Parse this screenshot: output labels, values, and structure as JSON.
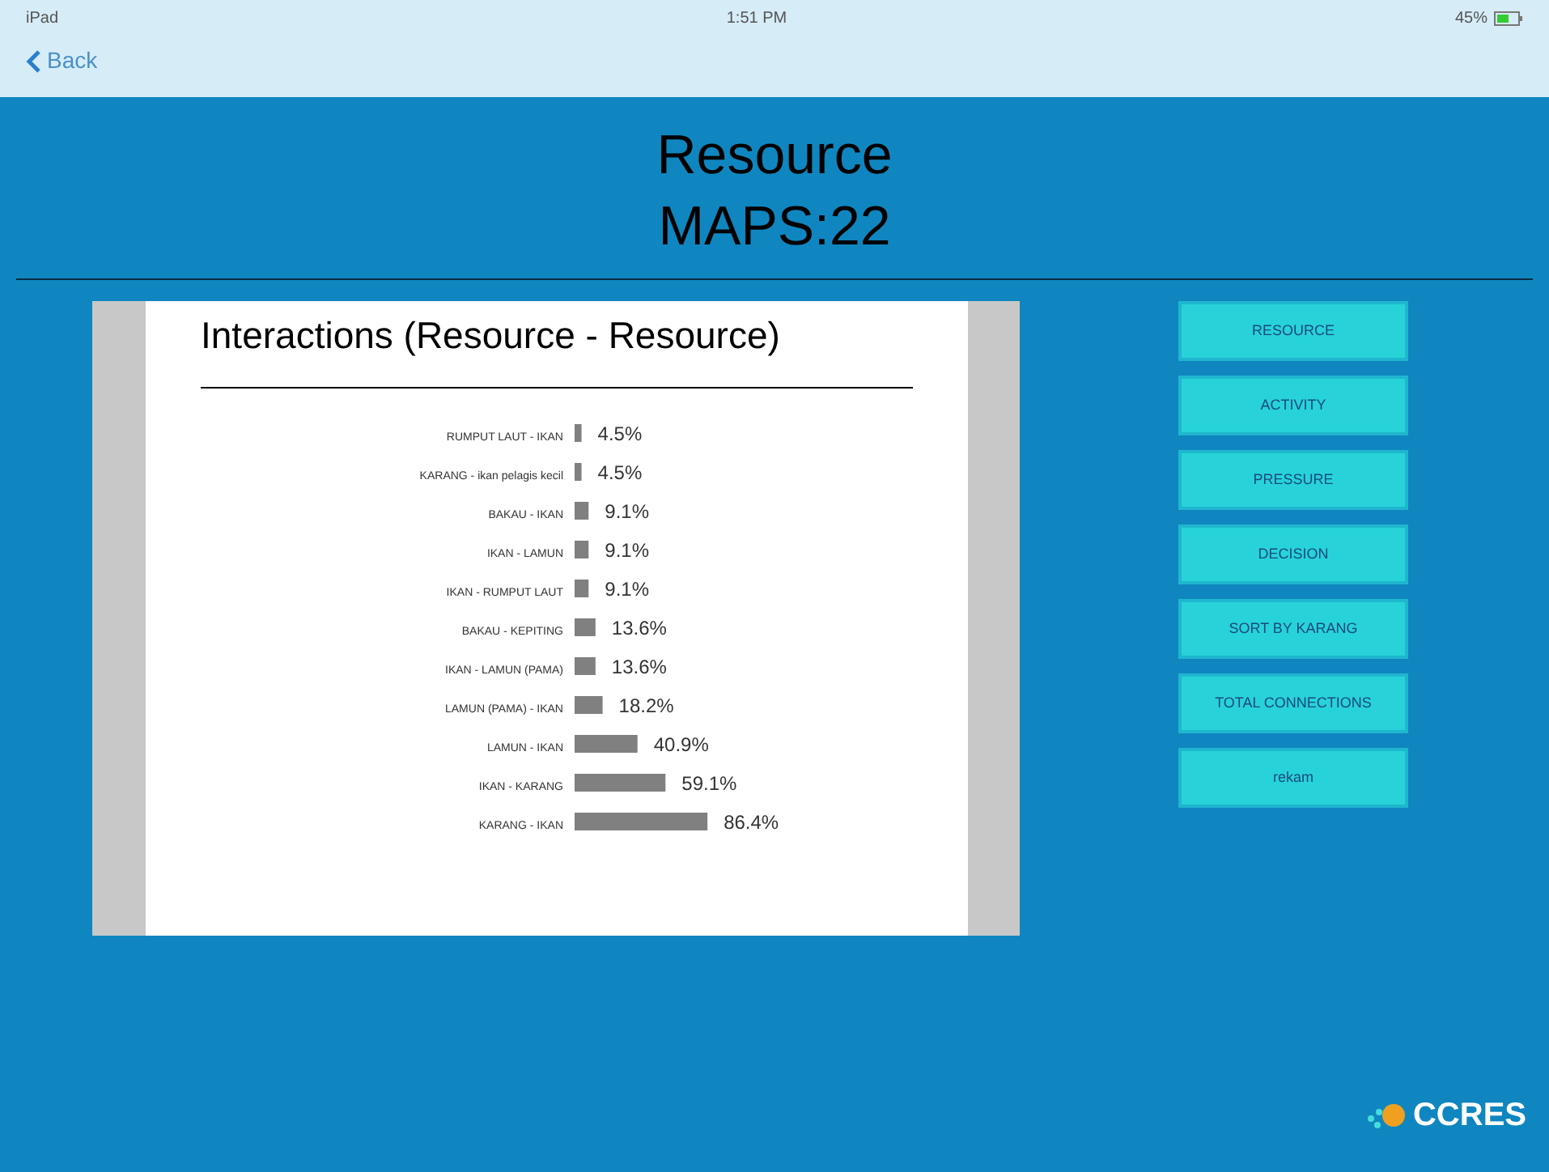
{
  "status_bar": {
    "device": "iPad",
    "time": "1:51 PM",
    "battery": "45%"
  },
  "nav": {
    "back": "Back"
  },
  "title": [
    "Resource",
    "MAPS:22"
  ],
  "chart": {
    "chart_data": {
      "type": "bar",
      "orientation": "horizontal",
      "title": "Interactions (Resource - Resource)",
      "categories": [
        "RUMPUT LAUT - IKAN",
        "KARANG - ikan pelagis kecil",
        "BAKAU - IKAN",
        "IKAN - LAMUN",
        "IKAN - RUMPUT LAUT",
        "BAKAU - KEPITING",
        "IKAN - LAMUN (PAMA)",
        "LAMUN (PAMA) - IKAN",
        "LAMUN - IKAN",
        "IKAN - KARANG",
        "KARANG - IKAN"
      ],
      "series": [
        {
          "color": "#808080",
          "values": [
            4.5,
            4.5,
            9.1,
            9.1,
            9.1,
            13.6,
            13.6,
            18.2,
            40.9,
            59.1,
            86.4
          ],
          "value_labels": [
            "4.5%",
            "4.5%",
            "9.1%",
            "9.1%",
            "9.1%",
            "13.6%",
            "13.6%",
            "18.2%",
            "40.9%",
            "59.1%",
            "86.4%"
          ]
        }
      ]
    }
  },
  "buttons": [
    "RESOURCE",
    "ACTIVITY",
    "PRESSURE",
    "DECISION",
    "SORT BY KARANG",
    "TOTAL CONNECTIONS",
    "rekam"
  ],
  "logo": "CCRES"
}
